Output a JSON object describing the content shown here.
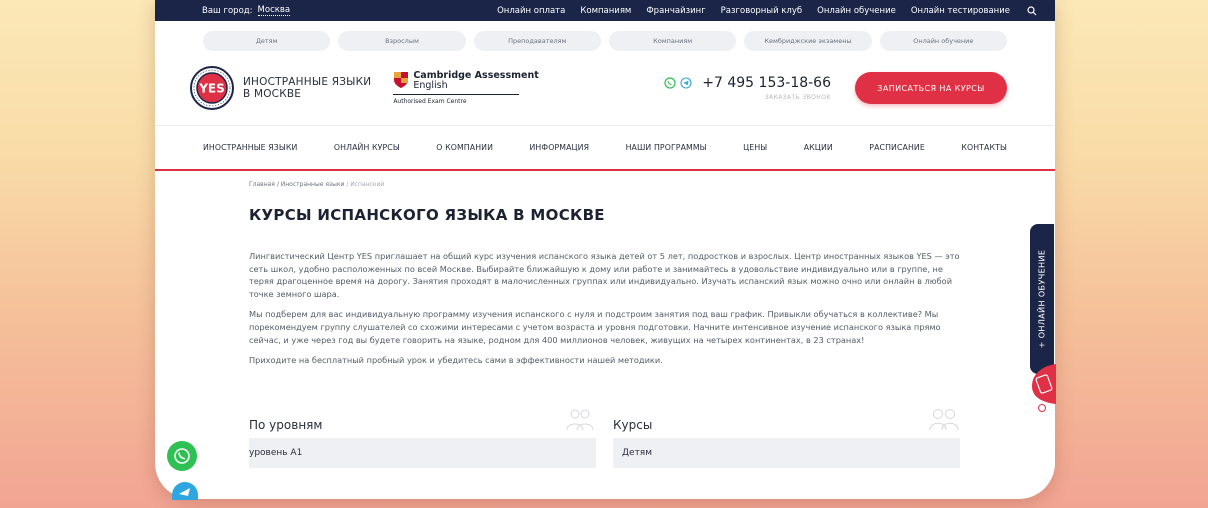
{
  "topbar": {
    "city_label": "Ваш город:",
    "city": "Москва",
    "links": [
      "Онлайн оплата",
      "Компаниям",
      "Франчайзинг",
      "Разговорный клуб",
      "Онлайн обучение",
      "Онлайн тестирование"
    ]
  },
  "pills": [
    "Детям",
    "Взрослым",
    "Преподавателям",
    "Компаниям",
    "Кембриджские экзамены",
    "Онлайн обучение"
  ],
  "logo": {
    "seal_text": "YES",
    "line1": "ИНОСТРАННЫЕ ЯЗЫКИ",
    "line2": "В МОСКВЕ"
  },
  "cambridge": {
    "name": "Cambridge Assessment",
    "lang": "English",
    "sub": "Authorised Exam Centre"
  },
  "contact": {
    "phone": "+7 495 153-18-66",
    "callback": "ЗАКАЗАТЬ ЗВОНОК",
    "cta": "ЗАПИСАТЬСЯ НА КУРСЫ"
  },
  "nav": [
    "ИНОСТРАННЫЕ ЯЗЫКИ",
    "ОНЛАЙН КУРСЫ",
    "О КОМПАНИИ",
    "ИНФОРМАЦИЯ",
    "НАШИ ПРОГРАММЫ",
    "ЦЕНЫ",
    "АКЦИИ",
    "РАСПИСАНИЕ",
    "КОНТАКТЫ"
  ],
  "breadcrumb": {
    "home": "Главная",
    "section": "/ Иностранные языки",
    "current": "/ Испанский"
  },
  "page": {
    "title": "КУРСЫ ИСПАНСКОГО ЯЗЫКА В МОСКВЕ",
    "paragraphs": [
      "Лингвистический Центр YES приглашает на общий курс изучения испанского языка детей от 5 лет, подростков и взрослых. Центр иностранных языков YES — это сеть школ, удобно расположенных по всей Москве. Выбирайте ближайшую к дому или работе и занимайтесь в удовольствие индивидуально или в группе, не теряя драгоценное время на дорогу. Занятия проходят в малочисленных группах или индивидуально. Изучать испанский язык можно очно или онлайн в любой точке земного шара.",
      "Мы подберем для вас индивидуальную программу изучения испанского с нуля и подстроим занятия под ваш график. Привыкли обучаться в коллективе? Мы порекомендуем группу слушателей со схожими интересами с учетом возраста и уровня подготовки. Начните интенсивное изучение испанского языка прямо сейчас, и уже через год вы будете говорить на языке, родном для 400 миллионов человек, живущих на четырех континентах, в 23 странах!",
      "Приходите на бесплатный пробный урок и убедитесь сами в эффективности нашей методики."
    ]
  },
  "levels": {
    "title": "По уровням",
    "first_item": "уровень А1"
  },
  "courses": {
    "title": "Курсы",
    "first_item": "Детям"
  },
  "side_tab": "+ ОНЛАЙН ОБУЧЕНИЕ",
  "colors": {
    "navy": "#1a2548",
    "accent": "#e03045",
    "whatsapp": "#2fc054",
    "telegram": "#2ea7e0"
  }
}
